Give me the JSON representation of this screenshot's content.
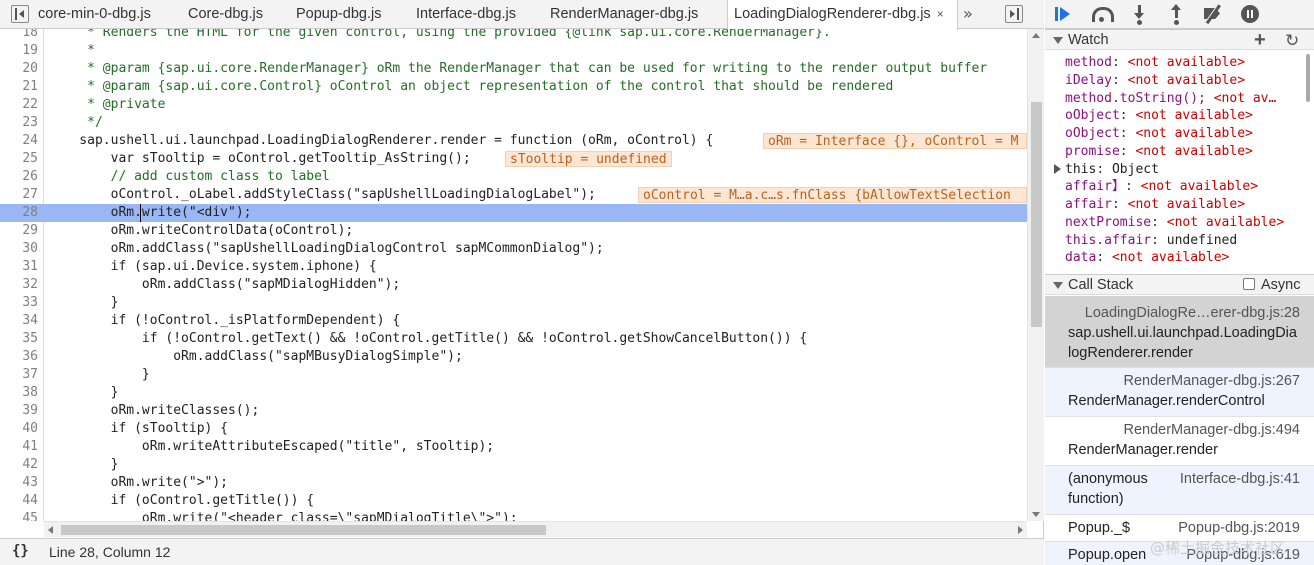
{
  "tabs": [
    {
      "label": "core-min-0-dbg.js",
      "active": false
    },
    {
      "label": "Core-dbg.js",
      "active": false
    },
    {
      "label": "Popup-dbg.js",
      "active": false
    },
    {
      "label": "Interface-dbg.js",
      "active": false
    },
    {
      "label": "RenderManager-dbg.js",
      "active": false
    },
    {
      "label": "LoadingDialogRenderer-dbg.js",
      "active": true
    }
  ],
  "tab_close": "×",
  "tab_overflow": "»",
  "code": {
    "lines": [
      {
        "n": "18",
        "text": "     * Renders the HTML for the given control, using the provided {@link sap.ui.core.RenderManager}."
      },
      {
        "n": "19",
        "text": "     *"
      },
      {
        "n": "20",
        "text": "     * @param {sap.ui.core.RenderManager} oRm the RenderManager that can be used for writing to the render output buffer"
      },
      {
        "n": "21",
        "text": "     * @param {sap.ui.core.Control} oControl an object representation of the control that should be rendered"
      },
      {
        "n": "22",
        "text": "     * @private"
      },
      {
        "n": "23",
        "text": "     */"
      },
      {
        "n": "24",
        "text": "    sap.ushell.ui.launchpad.LoadingDialogRenderer.render = function (oRm, oControl) {"
      },
      {
        "n": "25",
        "text": "        var sTooltip = oControl.getTooltip_AsString();"
      },
      {
        "n": "26",
        "text": "        // add custom class to label"
      },
      {
        "n": "27",
        "text": "        oControl._oLabel.addStyleClass(\"sapUshellLoadingDialogLabel\");"
      },
      {
        "n": "28",
        "text": "        oRm.write(\"<div\");"
      },
      {
        "n": "29",
        "text": "        oRm.writeControlData(oControl);"
      },
      {
        "n": "30",
        "text": "        oRm.addClass(\"sapUshellLoadingDialogControl sapMCommonDialog\");"
      },
      {
        "n": "31",
        "text": "        if (sap.ui.Device.system.iphone) {"
      },
      {
        "n": "32",
        "text": "            oRm.addClass(\"sapMDialogHidden\");"
      },
      {
        "n": "33",
        "text": "        }"
      },
      {
        "n": "34",
        "text": "        if (!oControl._isPlatformDependent) {"
      },
      {
        "n": "35",
        "text": "            if (!oControl.getText() && !oControl.getTitle() && !oControl.getShowCancelButton()) {"
      },
      {
        "n": "36",
        "text": "                oRm.addClass(\"sapMBusyDialogSimple\");"
      },
      {
        "n": "37",
        "text": "            }"
      },
      {
        "n": "38",
        "text": "        }"
      },
      {
        "n": "39",
        "text": "        oRm.writeClasses();"
      },
      {
        "n": "40",
        "text": "        if (sTooltip) {"
      },
      {
        "n": "41",
        "text": "            oRm.writeAttributeEscaped(\"title\", sTooltip);"
      },
      {
        "n": "42",
        "text": "        }"
      },
      {
        "n": "43",
        "text": "        oRm.write(\">\");"
      },
      {
        "n": "44",
        "text": "        if (oControl.getTitle()) {"
      },
      {
        "n": "45",
        "text": "            oRm.write(\"<header class=\\\"sapMDialogTitle\\\">\");"
      }
    ],
    "highlighted_line": "28",
    "inline_values": [
      {
        "line": "24",
        "text": "oRm = Interface {}, oControl = M"
      },
      {
        "line": "25",
        "text": "sTooltip = undefined"
      },
      {
        "line": "27",
        "text": "oControl = M…a.c…s.fnClass {bAllowTextSelection"
      }
    ]
  },
  "status": {
    "pretty_print": "{}",
    "cursor_position": "Line 28, Column 12"
  },
  "debugger": {
    "buttons": [
      "resume",
      "step-over",
      "step-into",
      "step-out",
      "deactivate-breakpoints",
      "pause-on-exceptions"
    ]
  },
  "watch": {
    "title": "Watch",
    "add": "+",
    "refresh": "↻",
    "items": [
      {
        "name": "method",
        "value": "<not available>"
      },
      {
        "name": "iDelay",
        "value": "<not available>"
      },
      {
        "name": "method.toString();",
        "value": "<not av…"
      },
      {
        "name": "oObject",
        "value": "<not available>"
      },
      {
        "name": "oObject",
        "value": "<not available>"
      },
      {
        "name": "promise",
        "value": "<not available>"
      },
      {
        "name": "this",
        "value": "Object",
        "expandable": true
      },
      {
        "name": "affair】",
        "value": "<not available>"
      },
      {
        "name": "affair",
        "value": "<not available>"
      },
      {
        "name": "nextPromise",
        "value": "<not available>"
      },
      {
        "name": "this.affair",
        "value": "undefined"
      },
      {
        "name": "data",
        "value": "<not available>"
      }
    ]
  },
  "call_stack": {
    "title": "Call Stack",
    "async_label": "Async",
    "frames": [
      {
        "location": "LoadingDialogRe…erer-dbg.js:28",
        "name": "sap.ushell.ui.launchpad.LoadingDialogRenderer.render",
        "name_lines": [
          "sap.ushell.ui.launchpad.LoadingDia",
          "logRenderer.render"
        ],
        "selected": true
      },
      {
        "location": "RenderManager-dbg.js:267",
        "name": "RenderManager.renderControl"
      },
      {
        "location": "RenderManager-dbg.js:494",
        "name": "RenderManager.render"
      },
      {
        "location": "Interface-dbg.js:41",
        "name": "(anonymous function)",
        "name_lines": [
          "(anonymous",
          "function)"
        ]
      },
      {
        "location": "Popup-dbg.js:2019",
        "name": "Popup._$"
      },
      {
        "location": "Popup-dbg.js:619",
        "name": "Popup.open"
      }
    ]
  },
  "watermark": "@稀土掘金技术社区"
}
